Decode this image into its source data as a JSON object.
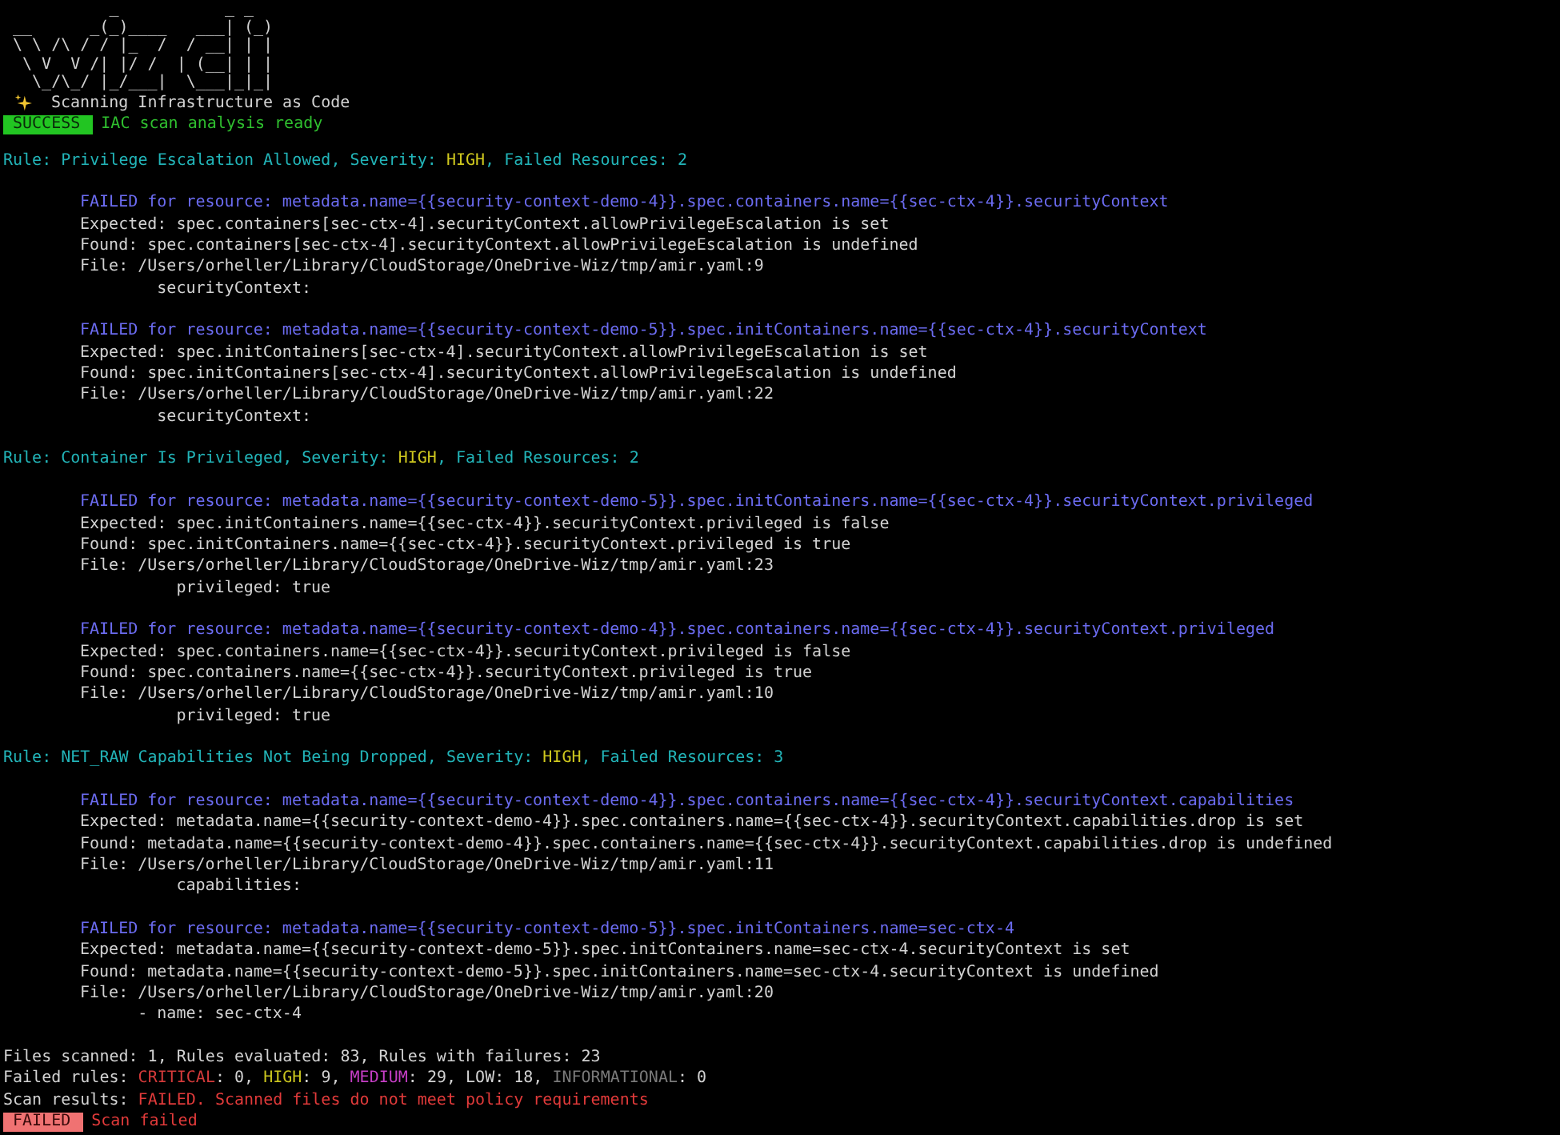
{
  "banner": {
    "logo_lines": [
      "          _           _ _ ",
      "__      _(_)____   ___| (_)",
      "\\ \\ /\\ / / |_  /  / __| | |",
      " \\ V  V /| |/ /  | (__| | |",
      "  \\_/\\_/ |_/___|  \\___|_|_|"
    ],
    "tagline": "Scanning Infrastructure as Code",
    "status": {
      "kind": "success",
      "badge": "SUCCESS",
      "message": "IAC scan analysis ready"
    }
  },
  "rules": [
    {
      "prefix": "Rule: Privilege Escalation Allowed, Severity: ",
      "severity": "HIGH",
      "suffix": ", Failed Resources: 2",
      "findings": [
        {
          "header": "FAILED for resource: metadata.name={{security-context-demo-4}}.spec.containers.name={{sec-ctx-4}}.securityContext",
          "expected": "Expected: spec.containers[sec-ctx-4].securityContext.allowPrivilegeEscalation is set",
          "found": "Found: spec.containers[sec-ctx-4].securityContext.allowPrivilegeEscalation is undefined",
          "file": "File: /Users/orheller/Library/CloudStorage/OneDrive-Wiz/tmp/amir.yaml:9",
          "snippet": "        securityContext:"
        },
        {
          "header": "FAILED for resource: metadata.name={{security-context-demo-5}}.spec.initContainers.name={{sec-ctx-4}}.securityContext",
          "expected": "Expected: spec.initContainers[sec-ctx-4].securityContext.allowPrivilegeEscalation is set",
          "found": "Found: spec.initContainers[sec-ctx-4].securityContext.allowPrivilegeEscalation is undefined",
          "file": "File: /Users/orheller/Library/CloudStorage/OneDrive-Wiz/tmp/amir.yaml:22",
          "snippet": "        securityContext:"
        }
      ]
    },
    {
      "prefix": "Rule: Container Is Privileged, Severity: ",
      "severity": "HIGH",
      "suffix": ", Failed Resources: 2",
      "findings": [
        {
          "header": "FAILED for resource: metadata.name={{security-context-demo-5}}.spec.initContainers.name={{sec-ctx-4}}.securityContext.privileged",
          "expected": "Expected: spec.initContainers.name={{sec-ctx-4}}.securityContext.privileged is false",
          "found": "Found: spec.initContainers.name={{sec-ctx-4}}.securityContext.privileged is true",
          "file": "File: /Users/orheller/Library/CloudStorage/OneDrive-Wiz/tmp/amir.yaml:23",
          "snippet": "          privileged: true"
        },
        {
          "header": "FAILED for resource: metadata.name={{security-context-demo-4}}.spec.containers.name={{sec-ctx-4}}.securityContext.privileged",
          "expected": "Expected: spec.containers.name={{sec-ctx-4}}.securityContext.privileged is false",
          "found": "Found: spec.containers.name={{sec-ctx-4}}.securityContext.privileged is true",
          "file": "File: /Users/orheller/Library/CloudStorage/OneDrive-Wiz/tmp/amir.yaml:10",
          "snippet": "          privileged: true"
        }
      ]
    },
    {
      "prefix": "Rule: NET_RAW Capabilities Not Being Dropped, Severity: ",
      "severity": "HIGH",
      "suffix": ", Failed Resources: 3",
      "findings": [
        {
          "header": "FAILED for resource: metadata.name={{security-context-demo-4}}.spec.containers.name={{sec-ctx-4}}.securityContext.capabilities",
          "expected": "Expected: metadata.name={{security-context-demo-4}}.spec.containers.name={{sec-ctx-4}}.securityContext.capabilities.drop is set",
          "found": "Found: metadata.name={{security-context-demo-4}}.spec.containers.name={{sec-ctx-4}}.securityContext.capabilities.drop is undefined",
          "file": "File: /Users/orheller/Library/CloudStorage/OneDrive-Wiz/tmp/amir.yaml:11",
          "snippet": "          capabilities:"
        },
        {
          "header": "FAILED for resource: metadata.name={{security-context-demo-5}}.spec.initContainers.name=sec-ctx-4",
          "expected": "Expected: metadata.name={{security-context-demo-5}}.spec.initContainers.name=sec-ctx-4.securityContext is set",
          "found": "Found: metadata.name={{security-context-demo-5}}.spec.initContainers.name=sec-ctx-4.securityContext is undefined",
          "file": "File: /Users/orheller/Library/CloudStorage/OneDrive-Wiz/tmp/amir.yaml:20",
          "snippet": "      - name: sec-ctx-4"
        }
      ]
    }
  ],
  "summary": {
    "totals": "Files scanned: 1, Rules evaluated: 83, Rules with failures: 23",
    "failed_rules_label": "Failed rules: ",
    "count_separator": ": ",
    "list_separator": ", ",
    "failed_rules": [
      {
        "severity": "CRITICAL",
        "count": "0",
        "color": "#d43a3a"
      },
      {
        "severity": "HIGH",
        "count": "9",
        "color": "#c9c41e"
      },
      {
        "severity": "MEDIUM",
        "count": "29",
        "color": "#c53ec5"
      },
      {
        "severity": "LOW",
        "count": "18",
        "color": "#d2d2d2"
      },
      {
        "severity": "INFORMATIONAL",
        "count": "0",
        "color": "#7a7a7a"
      }
    ],
    "results_label": "Scan results: ",
    "results": "FAILED. Scanned files do not meet policy requirements",
    "status": {
      "kind": "failed",
      "badge": "FAILED",
      "message": "Scan failed"
    }
  }
}
